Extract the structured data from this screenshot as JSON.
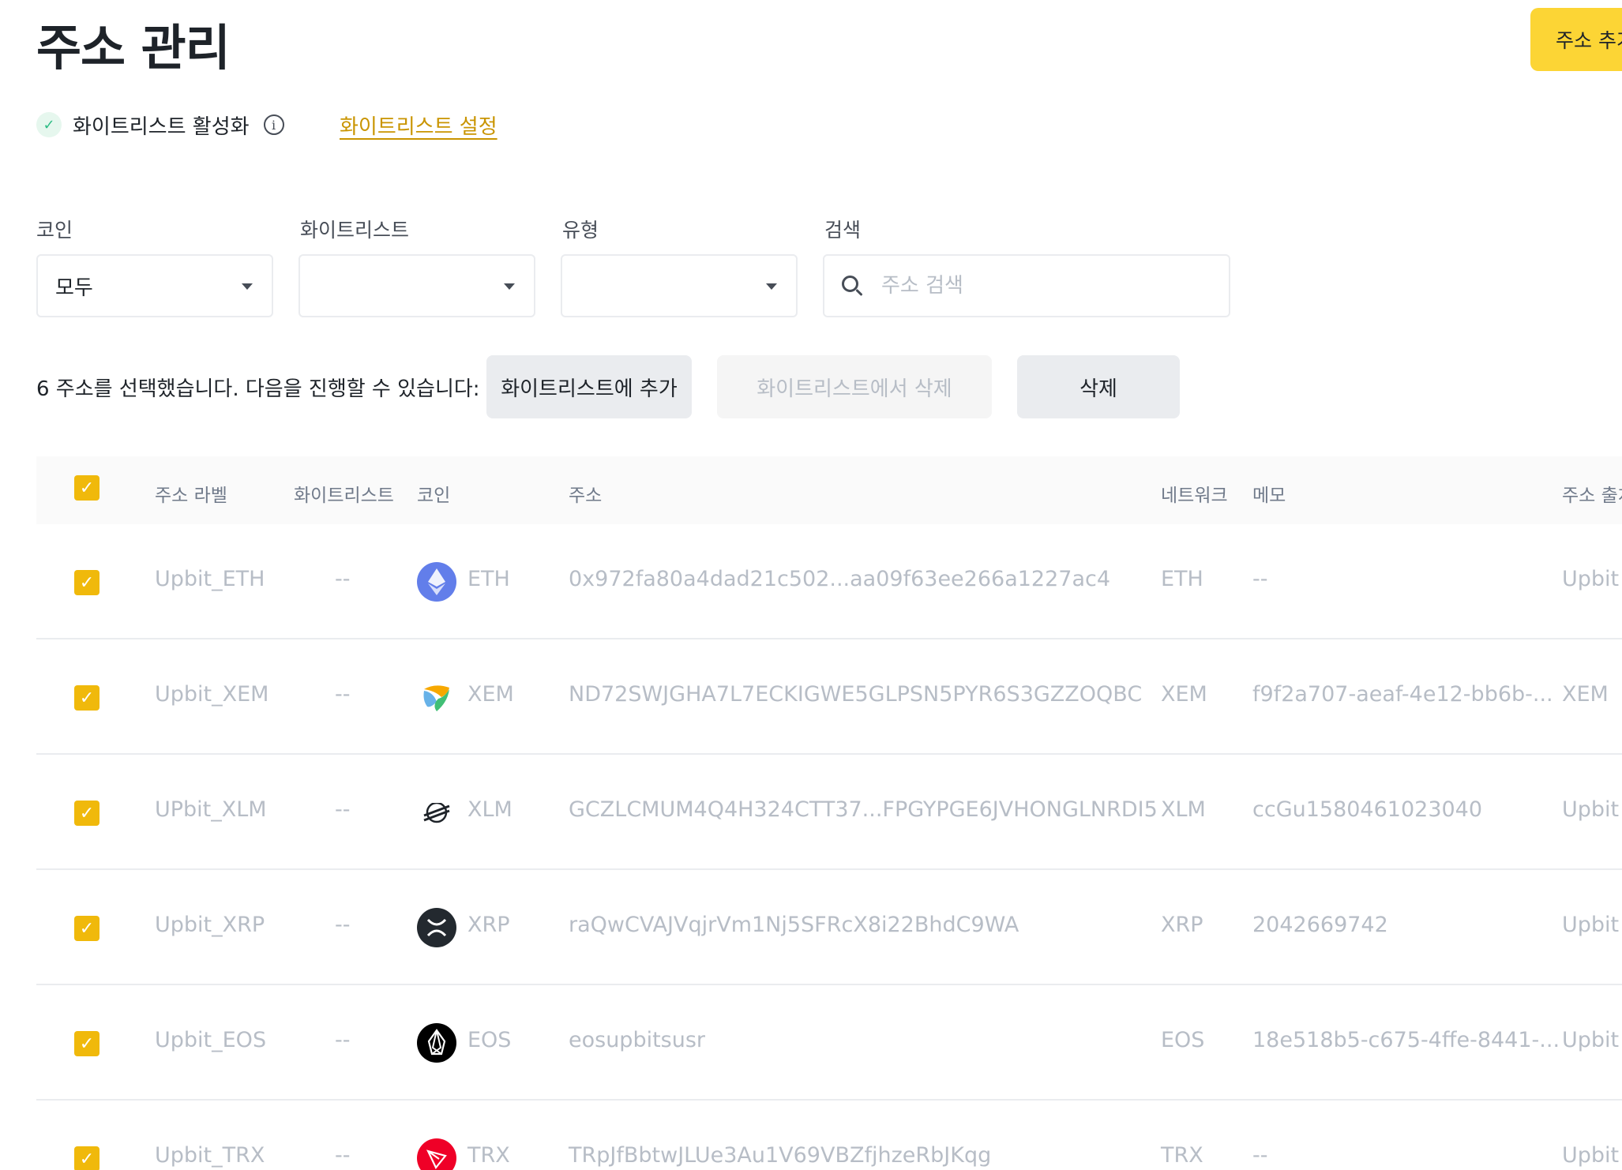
{
  "page_title": "주소 관리",
  "add_address_button": "주소 추가",
  "whitelist": {
    "status_label": "화이트리스트 활성화",
    "info_icon": "info-icon",
    "settings_link": "화이트리스트 설정"
  },
  "filters": {
    "coin": {
      "label": "코인",
      "value": "모두"
    },
    "whitelist": {
      "label": "화이트리스트",
      "value": ""
    },
    "type": {
      "label": "유형",
      "value": ""
    },
    "search": {
      "label": "검색",
      "placeholder": "주소 검색",
      "value": ""
    }
  },
  "selection": {
    "text": "6 주소를 선택했습니다. 다음을 진행할 수 있습니다:",
    "add_to_whitelist": "화이트리스트에 추가",
    "remove_from_whitelist": "화이트리스트에서 삭제",
    "delete": "삭제"
  },
  "table": {
    "columns": {
      "label": "주소 라벨",
      "whitelist": "화이트리스트",
      "coin": "코인",
      "address": "주소",
      "network": "네트워크",
      "memo": "메모",
      "origin": "주소 출처"
    },
    "rows": [
      {
        "label": "Upbit_ETH",
        "whitelist": "--",
        "coin": "ETH",
        "coin_icon": "eth-icon",
        "address": "0x972fa80a4dad21c502...aa09f63ee266a1227ac4",
        "network": "ETH",
        "memo": "--",
        "origin": "Upbit"
      },
      {
        "label": "Upbit_XEM",
        "whitelist": "--",
        "coin": "XEM",
        "coin_icon": "xem-icon",
        "address": "ND72SWJGHA7L7ECKIGWE5GLPSN5PYR6S3GZZOQBC",
        "network": "XEM",
        "memo": "f9f2a707-aeaf-4e12-bb6b-...",
        "origin": "XEM"
      },
      {
        "label": "UPbit_XLM",
        "whitelist": "--",
        "coin": "XLM",
        "coin_icon": "xlm-icon",
        "address": "GCZLCMUM4Q4H324CTT37...FPGYPGE6JVHONGLNRDI5",
        "network": "XLM",
        "memo": "ccGu1580461023040",
        "origin": "Upbit"
      },
      {
        "label": "Upbit_XRP",
        "whitelist": "--",
        "coin": "XRP",
        "coin_icon": "xrp-icon",
        "address": "raQwCVAJVqjrVm1Nj5SFRcX8i22BhdC9WA",
        "network": "XRP",
        "memo": "2042669742",
        "origin": "Upbit"
      },
      {
        "label": "Upbit_EOS",
        "whitelist": "--",
        "coin": "EOS",
        "coin_icon": "eos-icon",
        "address": "eosupbitsusr",
        "network": "EOS",
        "memo": "18e518b5-c675-4ffe-8441-...",
        "origin": "Upbit"
      },
      {
        "label": "Upbit_TRX",
        "whitelist": "--",
        "coin": "TRX",
        "coin_icon": "trx-icon",
        "address": "TRpJfBbtwJLUe3Au1V69VBZfjhzeRbJKqg",
        "network": "TRX",
        "memo": "--",
        "origin": "Upbit"
      }
    ]
  },
  "colors": {
    "accent": "#fcd535",
    "checkbox": "#f0b90b",
    "link": "#c99400",
    "success": "#2ebd85"
  }
}
